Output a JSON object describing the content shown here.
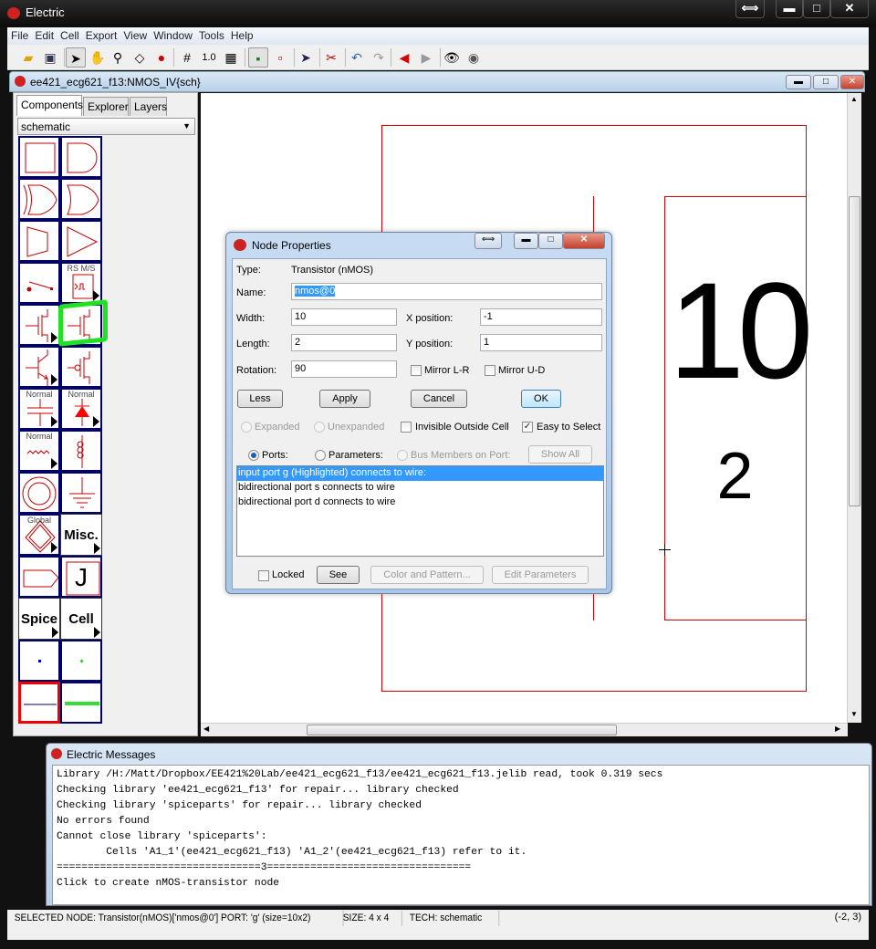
{
  "app": {
    "title": "Electric",
    "controls": [
      "⟺",
      "▬",
      "□",
      "✕"
    ]
  },
  "menu": [
    "File",
    "Edit",
    "Cell",
    "Export",
    "View",
    "Window",
    "Tools",
    "Help"
  ],
  "toolbar": {
    "grid_value": "1.0",
    "icons": [
      "open-folder",
      "save",
      "select-arrow",
      "pan-hand",
      "zoom",
      "edit-outline",
      "measure",
      "grid-larger",
      "grid-value",
      "grid-smaller",
      "outline-mode",
      "full-mode",
      "select-special",
      "tools",
      "undo",
      "redo",
      "back",
      "forward",
      "show-all",
      "hide"
    ]
  },
  "cell_window": {
    "title": "ee421_ecg621_f13:NMOS_IV{sch}"
  },
  "left_panel": {
    "tabs": [
      "Components",
      "Explorer",
      "Layers"
    ],
    "active_tab": "Components",
    "technology": "schematic",
    "palette": [
      {
        "icon": "buffer-box"
      },
      {
        "icon": "and-gate"
      },
      {
        "icon": "xor-gate"
      },
      {
        "icon": "or-gate"
      },
      {
        "icon": "mux"
      },
      {
        "icon": "triangle-buffer"
      },
      {
        "icon": "switch"
      },
      {
        "icon": "flipflop",
        "label": "RS M/S",
        "more": true
      },
      {
        "icon": "nmos-4port",
        "more": true
      },
      {
        "icon": "nmos-transistor",
        "highlighted": true
      },
      {
        "icon": "npn-transistor",
        "more": true
      },
      {
        "icon": "pmos-transistor"
      },
      {
        "icon": "capacitor",
        "label": "Normal",
        "more": true
      },
      {
        "icon": "diode",
        "label": "Normal",
        "more": true
      },
      {
        "icon": "resistor",
        "label": "Normal",
        "more": true
      },
      {
        "icon": "inductor"
      },
      {
        "icon": "power"
      },
      {
        "icon": "ground"
      },
      {
        "icon": "global",
        "label": "Global",
        "more": true
      },
      {
        "icon": "text",
        "label": "Misc.",
        "more": true
      },
      {
        "icon": "off-page"
      },
      {
        "icon": "letter",
        "label": "J"
      },
      {
        "icon": "text",
        "label": "Spice",
        "more": true
      },
      {
        "icon": "text",
        "label": "Cell",
        "more": true
      },
      {
        "icon": "pin"
      },
      {
        "icon": "bus-pin"
      },
      {
        "icon": "wire",
        "selected": true
      },
      {
        "icon": "bus"
      }
    ]
  },
  "canvas": {
    "width_label": "10",
    "length_label": "2",
    "wire_color": "#d40000"
  },
  "dialog": {
    "title": "Node Properties",
    "type_label": "Type:",
    "type_value": "Transistor (nMOS)",
    "name_label": "Name:",
    "name_value": "nmos@0",
    "width_label": "Width:",
    "width_value": "10",
    "xpos_label": "X position:",
    "xpos_value": "-1",
    "length_label": "Length:",
    "length_value": "2",
    "ypos_label": "Y position:",
    "ypos_value": "1",
    "rotation_label": "Rotation:",
    "rotation_value": "90",
    "mirror_lr": "Mirror L-R",
    "mirror_ud": "Mirror U-D",
    "less": "Less",
    "apply": "Apply",
    "cancel": "Cancel",
    "ok": "OK",
    "expanded": "Expanded",
    "unexpanded": "Unexpanded",
    "invisible_outside": "Invisible Outside Cell",
    "easy_select": "Easy to Select",
    "easy_select_checked": true,
    "ports": "Ports:",
    "parameters": "Parameters:",
    "bus_members": "Bus Members on Port:",
    "show_all": "Show All",
    "port_list": [
      "input port g (Highlighted) connects to wire:",
      "bidirectional port s connects to wire",
      "bidirectional port d connects to wire"
    ],
    "locked": "Locked",
    "see": "See",
    "color_pattern": "Color and Pattern...",
    "edit_params": "Edit Parameters"
  },
  "messages": {
    "title": "Electric Messages",
    "lines": [
      "Library /H:/Matt/Dropbox/EE421%20Lab/ee421_ecg621_f13/ee421_ecg621_f13.jelib read, took 0.319 secs",
      "Checking library 'ee421_ecg621_f13' for repair... library checked",
      "Checking library 'spiceparts' for repair... library checked",
      "No errors found",
      "Cannot close library 'spiceparts':",
      "        Cells 'A1_1'(ee421_ecg621_f13) 'A1_2'(ee421_ecg621_f13) refer to it.",
      "=================================3=================================",
      "Click to create nMOS-transistor node"
    ]
  },
  "status": {
    "selected": "SELECTED NODE: Transistor(nMOS)['nmos@0'] PORT: 'g' (size=10x2)",
    "size": "SIZE: 4 x 4",
    "tech": "TECH: schematic",
    "coords": "(-2, 3)"
  }
}
